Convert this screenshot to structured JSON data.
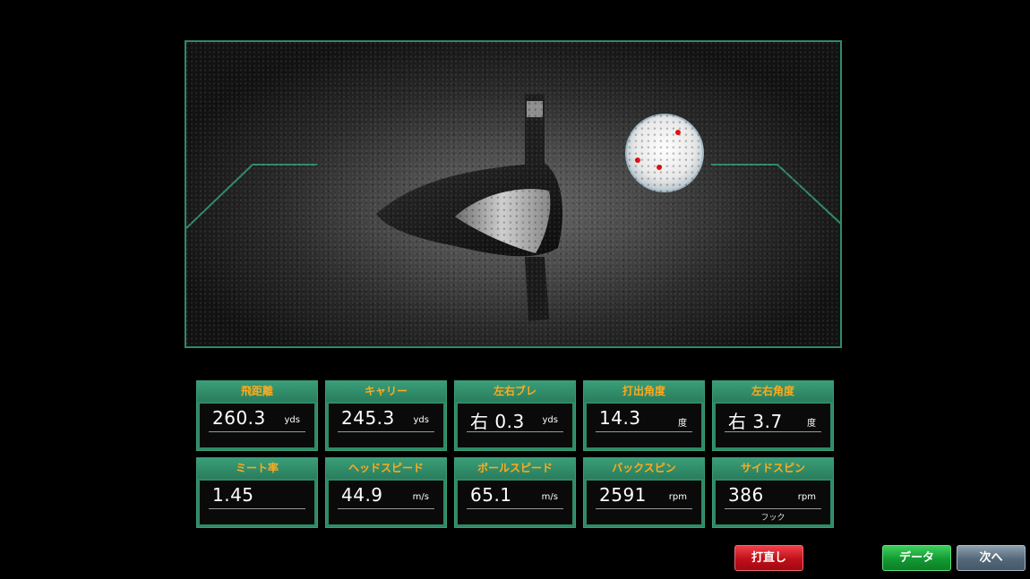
{
  "colors": {
    "accent_green": "#2f8a66",
    "label_orange": "#ffaa1e",
    "retry_red": "#c0101a",
    "data_green": "#139a33",
    "next_gray": "#54687a",
    "ball_marker_red": "#e01010"
  },
  "camera_view": {
    "image": "impact-camera-image",
    "ball_marker_count": 3
  },
  "metrics": [
    {
      "label": "飛距離",
      "value": "260.3",
      "unit": "yds",
      "sub": ""
    },
    {
      "label": "キャリー",
      "value": "245.3",
      "unit": "yds",
      "sub": ""
    },
    {
      "label": "左右ブレ",
      "value": "右 0.3",
      "unit": "yds",
      "sub": ""
    },
    {
      "label": "打出角度",
      "value": "14.3",
      "unit": "度",
      "sub": ""
    },
    {
      "label": "左右角度",
      "value": "右 3.7",
      "unit": "度",
      "sub": ""
    },
    {
      "label": "ミート率",
      "value": "1.45",
      "unit": "",
      "sub": ""
    },
    {
      "label": "ヘッドスピード",
      "value": "44.9",
      "unit": "m/s",
      "sub": ""
    },
    {
      "label": "ボールスピード",
      "value": "65.1",
      "unit": "m/s",
      "sub": ""
    },
    {
      "label": "バックスピン",
      "value": "2591",
      "unit": "rpm",
      "sub": ""
    },
    {
      "label": "サイドスピン",
      "value": "386",
      "unit": "rpm",
      "sub": "フック"
    }
  ],
  "buttons": {
    "retry_label": "打直し",
    "data_label": "データ",
    "next_label": "次へ"
  }
}
